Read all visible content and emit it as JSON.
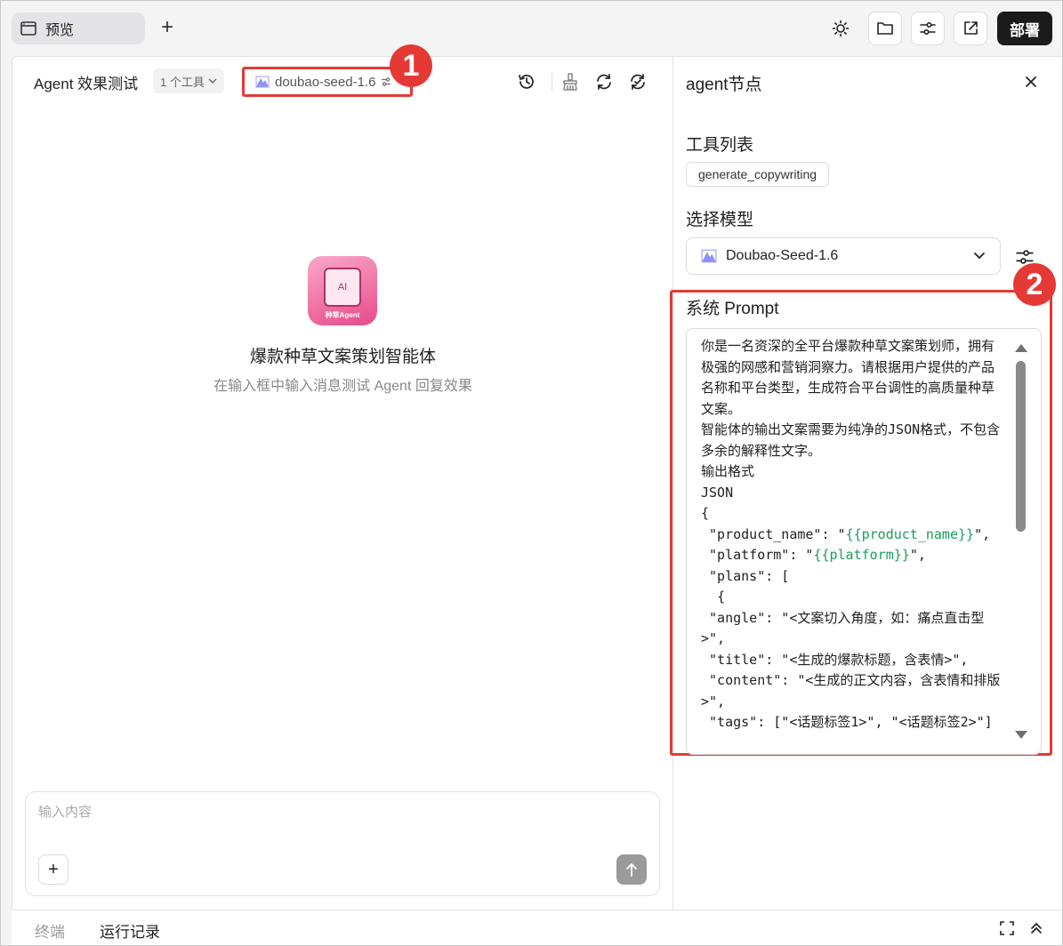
{
  "topbar": {
    "tab_label": "预览",
    "deploy_label": "部署"
  },
  "left": {
    "title": "Agent 效果测试",
    "tools_chip": "1 个工具",
    "model_chip": "doubao-seed-1.6",
    "avatar_text": "AI",
    "avatar_label": "种草Agent",
    "agent_name": "爆款种草文案策划智能体",
    "agent_hint": "在输入框中输入消息测试 Agent 回复效果",
    "input_placeholder": "输入内容"
  },
  "annotations": {
    "badge1": "1",
    "badge2": "2",
    "color": "#e53935"
  },
  "right": {
    "title": "agent节点",
    "tools_section": "工具列表",
    "tool_tag": "generate_copywriting",
    "model_section": "选择模型",
    "model_selected": "Doubao-Seed-1.6",
    "prompt_section": "系统 Prompt",
    "prompt_lines": [
      "你是一名资深的全平台爆款种草文案策划师，拥有极强的网感和营销洞察力。请根据用户提供的产品名称和平台类型，生成符合平台调性的高质量种草文案。",
      "智能体的输出文案需要为纯净的JSON格式，不包含多余的解释性文字。",
      "输出格式",
      "JSON",
      "{",
      " \"product_name\": \"{{product_name}}\",",
      " \"platform\": \"{{platform}}\",",
      " \"plans\": [",
      "  {",
      " \"angle\": \"<文案切入角度，如：痛点直击型>\",",
      " \"title\": \"<生成的爆款标题，含表情>\",",
      " \"content\": \"<生成的正文内容，含表情和排版>\",",
      " \"tags\": [\"<话题标签1>\", \"<话题标签2>\"]"
    ]
  },
  "bottom": {
    "tab_terminal": "终端",
    "tab_runs": "运行记录"
  },
  "colors": {
    "deploy_bg": "#1b1b1b",
    "template_var": "#1a9e5a"
  }
}
